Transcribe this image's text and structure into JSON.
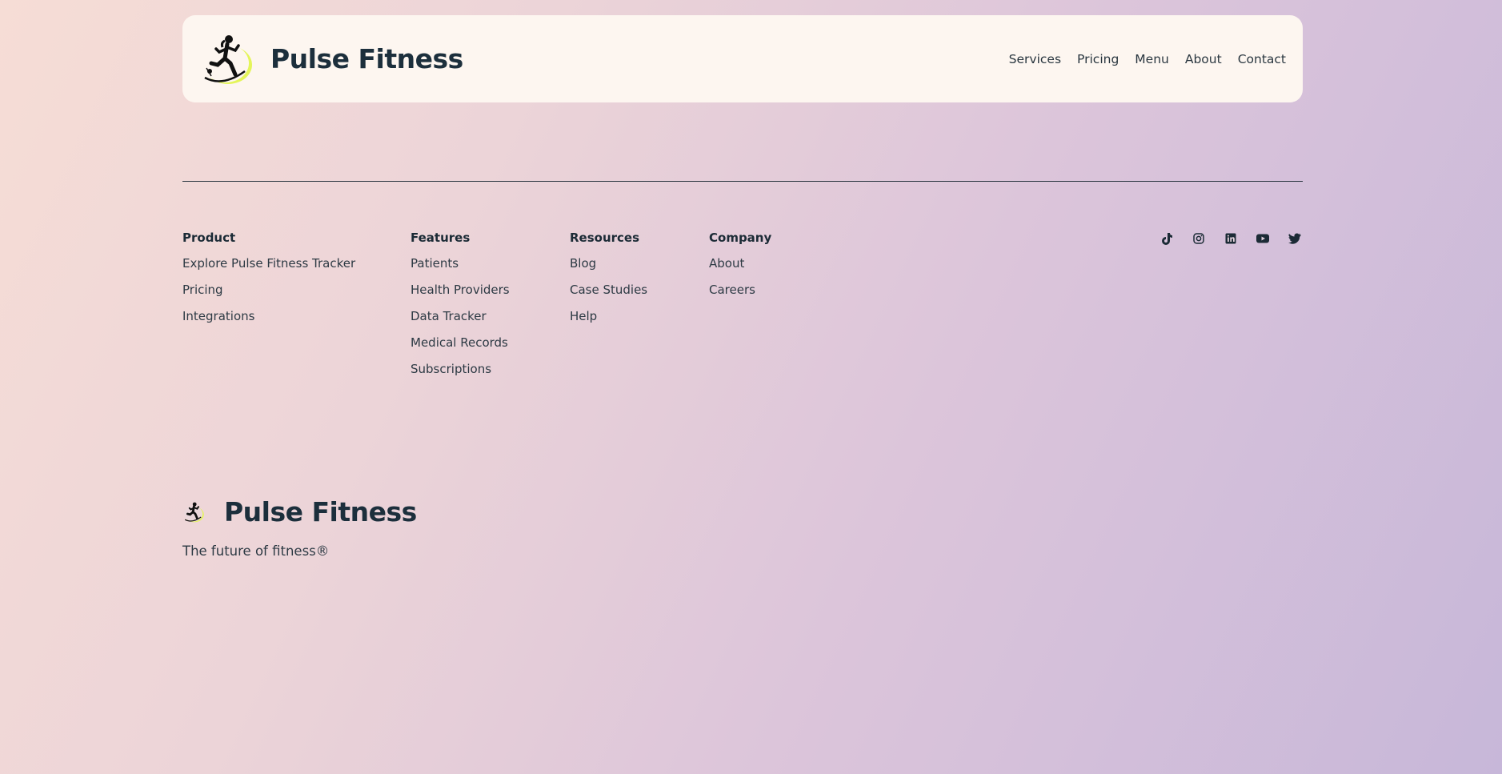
{
  "brand": {
    "name": "Pulse Fitness",
    "logo_icon": "runner-logo-icon",
    "accent": "#e4f55a"
  },
  "nav": [
    {
      "label": "Services"
    },
    {
      "label": "Pricing"
    },
    {
      "label": "Menu"
    },
    {
      "label": "About"
    },
    {
      "label": "Contact"
    }
  ],
  "footer": {
    "product": {
      "title": "Product",
      "links": [
        "Explore Pulse Fitness Tracker",
        "Pricing",
        "Integrations"
      ]
    },
    "features": {
      "title": "Features",
      "links": [
        "Patients",
        "Health Providers",
        "Data Tracker",
        "Medical Records",
        "Subscriptions"
      ]
    },
    "resources": {
      "title": "Resources",
      "links": [
        "Blog",
        "Case Studies",
        "Help"
      ]
    },
    "company": {
      "title": "Company",
      "links": [
        "About",
        "Careers"
      ]
    },
    "social": [
      "tiktok-icon",
      "instagram-icon",
      "linkedin-icon",
      "youtube-icon",
      "twitter-icon"
    ]
  },
  "bottom": {
    "name": "Pulse Fitness",
    "tagline": "The future of fitness®"
  }
}
